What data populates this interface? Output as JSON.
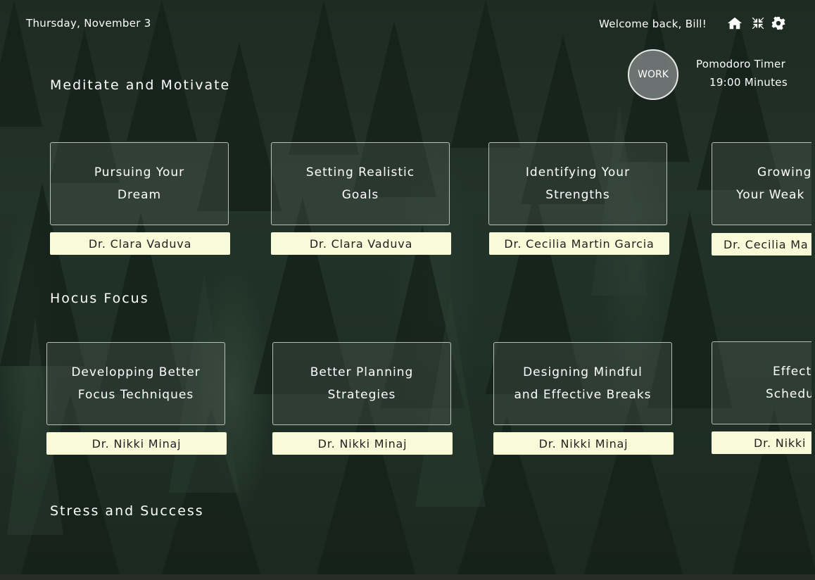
{
  "header": {
    "date": "Thursday, November 3",
    "welcome": "Welcome back, Bill!",
    "icons": [
      "home-icon",
      "compress-icon",
      "gear-icon"
    ]
  },
  "pomodoro": {
    "mode": "WORK",
    "title": "Pomodoro Timer",
    "time": "19:00 Minutes"
  },
  "sections": [
    {
      "title": "Meditate and Motivate",
      "cards": [
        {
          "line1": "Pursuing Your",
          "line2": "Dream",
          "author": "Dr. Clara Vaduva"
        },
        {
          "line1": "Setting Realistic",
          "line2": "Goals",
          "author": "Dr. Clara Vaduva"
        },
        {
          "line1": "Identifying Your",
          "line2": "Strengths",
          "author": "Dr. Cecilia Martin Garcia"
        },
        {
          "line1": "Growing",
          "line2": "Your Weak",
          "author": "Dr. Cecilia Ma"
        }
      ]
    },
    {
      "title": "Hocus Focus",
      "cards": [
        {
          "line1": "Developping Better",
          "line2": "Focus Techniques",
          "author": "Dr. Nikki Minaj"
        },
        {
          "line1": "Better Planning",
          "line2": "Strategies",
          "author": "Dr. Nikki Minaj"
        },
        {
          "line1": "Designing Mindful",
          "line2": "and Effective Breaks",
          "author": "Dr. Nikki Minaj"
        },
        {
          "line1": "Effect",
          "line2": "Schedu",
          "author": "Dr. Nikki"
        }
      ]
    },
    {
      "title": "Stress and Success",
      "cards": []
    }
  ],
  "colors": {
    "author_bg": "#f8fad8",
    "card_border": "#e6ebe6",
    "background": "#1e2b22"
  }
}
